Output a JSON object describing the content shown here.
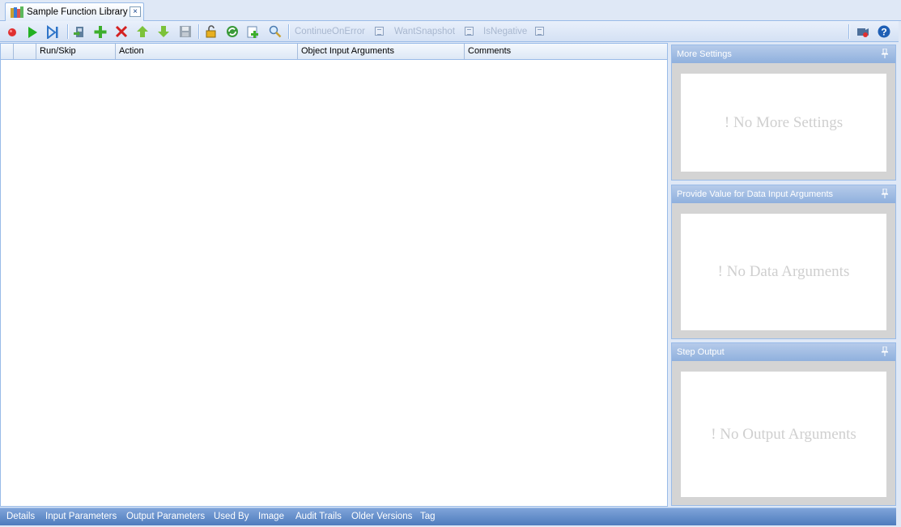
{
  "tab": {
    "title": "Sample Function Library",
    "close": "×"
  },
  "toolbar": {
    "record": "record-icon",
    "run": "play-icon",
    "run_to": "step-icon",
    "toggles": [
      {
        "label": "ContinueOnError"
      },
      {
        "label": "WantSnapshot"
      },
      {
        "label": "IsNegative"
      }
    ]
  },
  "grid": {
    "columns": [
      "",
      "",
      "Run/Skip",
      "Action",
      "Object Input Arguments",
      "Comments"
    ]
  },
  "panels": [
    {
      "title": "More Settings",
      "message": "! No More Settings"
    },
    {
      "title": "Provide Value for Data Input Arguments",
      "message": "! No Data Arguments"
    },
    {
      "title": "Step Output",
      "message": "! No Output Arguments"
    }
  ],
  "bottom_tabs": [
    "Details",
    "Input Parameters",
    "Output Parameters",
    "Used By",
    "Image",
    "Audit Trails",
    "Older Versions",
    "Tag"
  ],
  "colors": {
    "accent": "#15428b",
    "border": "#99bbe8",
    "panel_header": "#8fb0dd",
    "bottom_bar": "#4e7bbd"
  }
}
